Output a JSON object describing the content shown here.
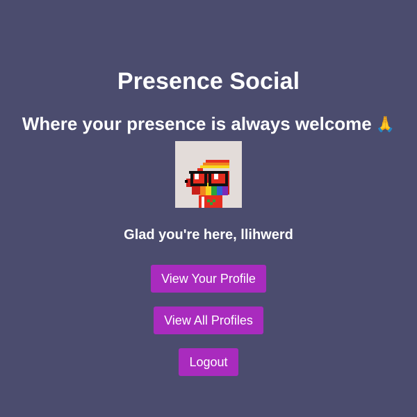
{
  "app": {
    "title": "Presence Social",
    "tagline": "Where your presence is always welcome",
    "tagline_emoji": "🙏"
  },
  "user": {
    "greeting": "Glad you're here, llihwerd"
  },
  "actions": {
    "view_profile_label": "View Your Profile",
    "view_all_label": "View All Profiles",
    "logout_label": "Logout"
  },
  "theme": {
    "background": "#4b4c6e",
    "button": "#a92bbe",
    "avatar_background": "#e3dcd9"
  }
}
